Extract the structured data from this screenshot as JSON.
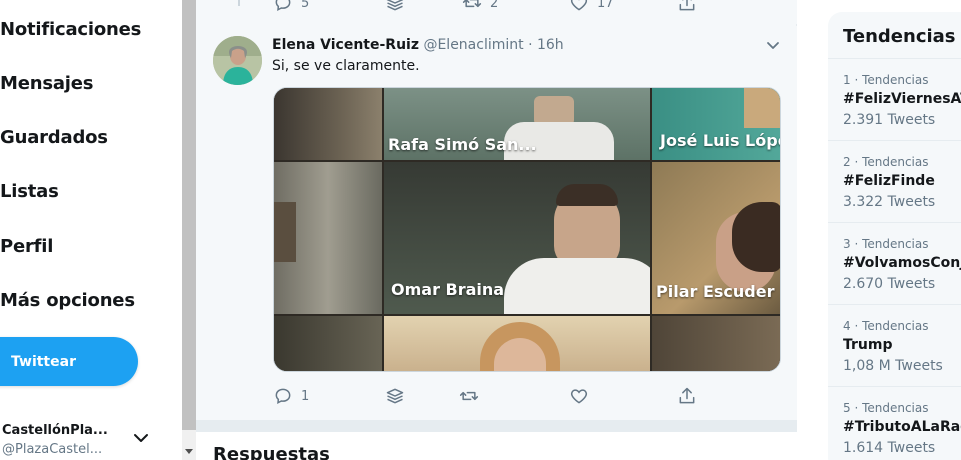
{
  "nav": {
    "items": [
      {
        "label": "Notificaciones"
      },
      {
        "label": "Mensajes"
      },
      {
        "label": "Guardados"
      },
      {
        "label": "Listas"
      },
      {
        "label": "Perfil"
      },
      {
        "label": "Más opciones"
      }
    ],
    "tweet_button": "Twittear",
    "account": {
      "name": "CastellónPla...",
      "handle": "@PlazaCastel..."
    }
  },
  "previous_tweet_actions": {
    "reply_count": "5",
    "retweet_count": "2",
    "like_count": "17"
  },
  "tweet": {
    "author_name": "Elena Vicente-Ruiz",
    "author_handle": "@Elenaclimint",
    "separator": "·",
    "time": "16h",
    "text": "Si, se ve claramente.",
    "media": {
      "labels": [
        "Rafa Simó San...",
        "José Luis López",
        "Omar Braina",
        "Pilar Escuder"
      ]
    },
    "actions": {
      "reply_count": "1"
    }
  },
  "replies": {
    "title": "Respuestas"
  },
  "trends": {
    "title": "Tendencias para ti",
    "items": [
      {
        "meta": "1 · Tendencias",
        "name": "#FelizViernesAToda",
        "count": "2.391 Tweets"
      },
      {
        "meta": "2 · Tendencias",
        "name": "#FelizFinde",
        "count": "3.322 Tweets"
      },
      {
        "meta": "3 · Tendencias",
        "name": "#VolvamosConJuntos",
        "count": "2.670 Tweets"
      },
      {
        "meta": "4 · Tendencias",
        "name": "Trump",
        "count": "1,08 M Tweets"
      },
      {
        "meta": "5 · Tendencias",
        "name": "#TributoALaRadio",
        "count": "1.614 Tweets"
      }
    ]
  },
  "colors": {
    "accent": "#1da1f2",
    "text": "#14171a",
    "muted": "#657786"
  },
  "icons": [
    "reply-icon",
    "share-via-icon",
    "retweet-icon",
    "like-icon",
    "share-icon",
    "chevron-down-icon"
  ]
}
